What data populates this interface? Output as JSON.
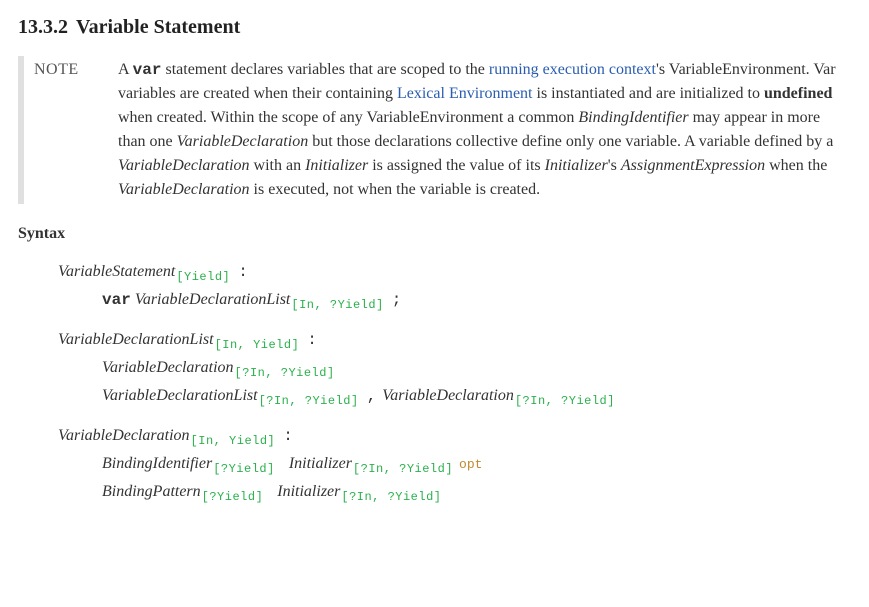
{
  "heading": {
    "number": "13.3.2",
    "title": "Variable Statement"
  },
  "note": {
    "label": "NOTE",
    "t1": "A ",
    "kw1": "var",
    "t2": " statement declares variables that are scoped to the ",
    "link1": "running execution context",
    "t3": "'s VariableEnvironment. Var variables are created when their containing ",
    "link2": "Lexical Environment",
    "t4": " is instantiated and are initialized to ",
    "bold1": "undefined",
    "t5": " when created. Within the scope of any VariableEnvironment a common ",
    "nt1": "BindingIdentifier",
    "t6": " may appear in more than one ",
    "nt2": "VariableDeclaration",
    "t7": " but those declarations collective define only one variable. A variable defined by a ",
    "nt3": "VariableDeclaration",
    "t8": " with an ",
    "nt4": "Initializer",
    "t9": " is assigned the value of its ",
    "nt5": "Initializer",
    "t10": "'s ",
    "nt6": "AssignmentExpression",
    "t11": " when the ",
    "nt7": "VariableDeclaration",
    "t12": " is executed, not when the variable is created."
  },
  "syntax_heading": "Syntax",
  "grammar": {
    "p1": {
      "lhs_nt": "VariableStatement",
      "lhs_params": "[Yield]",
      "r1_kw": "var",
      "r1_nt": "VariableDeclarationList",
      "r1_params": "[In, ?Yield]",
      "r1_punct": ";"
    },
    "p2": {
      "lhs_nt": "VariableDeclarationList",
      "lhs_params": "[In, Yield]",
      "r1_nt": "VariableDeclaration",
      "r1_params": "[?In, ?Yield]",
      "r2_nt1": "VariableDeclarationList",
      "r2_params1": "[?In, ?Yield]",
      "r2_punct": ",",
      "r2_nt2": "VariableDeclaration",
      "r2_params2": "[?In, ?Yield]"
    },
    "p3": {
      "lhs_nt": "VariableDeclaration",
      "lhs_params": "[In, Yield]",
      "r1_nt1": "BindingIdentifier",
      "r1_params1": "[?Yield]",
      "r1_nt2": "Initializer",
      "r1_params2": "[?In, ?Yield]",
      "r1_opt": "opt",
      "r2_nt1": "BindingPattern",
      "r2_params1": "[?Yield]",
      "r2_nt2": "Initializer",
      "r2_params2": "[?In, ?Yield]"
    },
    "colon": ":"
  }
}
